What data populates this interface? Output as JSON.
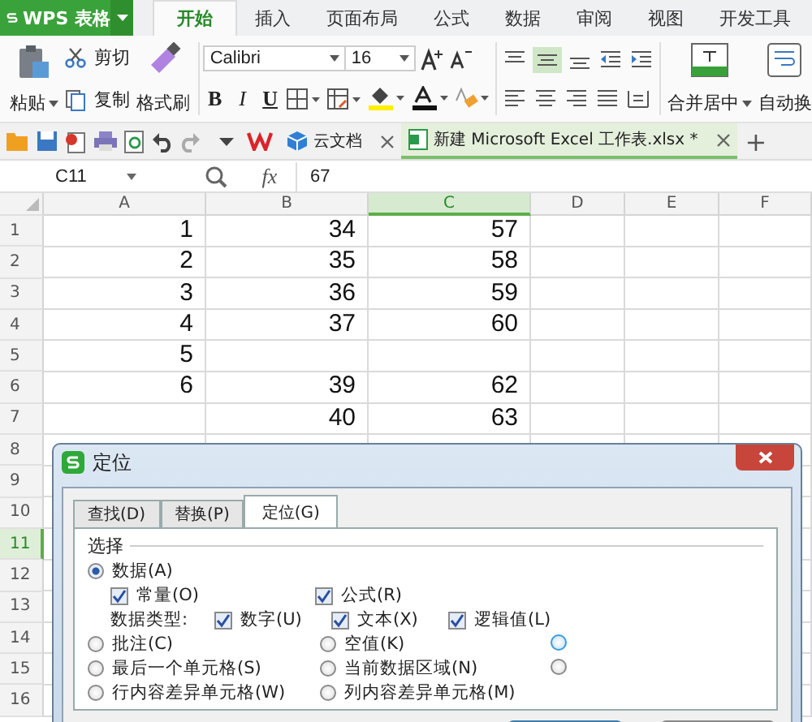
{
  "app_menu": {
    "label": "WPS 表格"
  },
  "ribbon_tabs": [
    {
      "label": "开始",
      "selected": true
    },
    {
      "label": "插入",
      "selected": false
    },
    {
      "label": "页面布局",
      "selected": false
    },
    {
      "label": "公式",
      "selected": false
    },
    {
      "label": "数据",
      "selected": false
    },
    {
      "label": "审阅",
      "selected": false
    },
    {
      "label": "视图",
      "selected": false
    },
    {
      "label": "开发工具",
      "selected": false
    }
  ],
  "ribbon": {
    "paste": "粘贴",
    "cut": "剪切",
    "copy": "复制",
    "format_painter": "格式刷",
    "font_name": "Calibri",
    "font_size": "16",
    "bold": "B",
    "italic": "I",
    "underline": "U",
    "merge": "合并居中",
    "wrap": "自动换"
  },
  "doc_tabs": [
    {
      "label": "云文档",
      "selected": false
    },
    {
      "label": "新建 Microsoft Excel 工作表.xlsx *",
      "selected": true
    }
  ],
  "doc_tab_add": "+",
  "formula_bar": {
    "cell": "C11",
    "fx": "fx",
    "value": "67"
  },
  "sheet": {
    "columns": [
      {
        "label": "A",
        "selected": false
      },
      {
        "label": "B",
        "selected": false
      },
      {
        "label": "C",
        "selected": true
      },
      {
        "label": "D",
        "selected": false
      },
      {
        "label": "E",
        "selected": false
      },
      {
        "label": "F",
        "selected": false
      }
    ],
    "rows": [
      {
        "number": "1",
        "selected": false,
        "cells": [
          "1",
          "34",
          "57"
        ]
      },
      {
        "number": "2",
        "selected": false,
        "cells": [
          "2",
          "35",
          "58"
        ]
      },
      {
        "number": "3",
        "selected": false,
        "cells": [
          "3",
          "36",
          "59"
        ]
      },
      {
        "number": "4",
        "selected": false,
        "cells": [
          "4",
          "37",
          "60"
        ]
      },
      {
        "number": "5",
        "selected": false,
        "cells": [
          "5"
        ]
      },
      {
        "number": "6",
        "selected": false,
        "cells": [
          "6",
          "39",
          "62"
        ]
      },
      {
        "number": "7",
        "selected": false,
        "cells": [
          "",
          "40",
          "63"
        ]
      },
      {
        "number": "8",
        "selected": false,
        "cells": []
      },
      {
        "number": "9",
        "selected": false,
        "cells": []
      },
      {
        "number": "10",
        "selected": false,
        "cells": []
      },
      {
        "number": "11",
        "selected": true,
        "cells": []
      },
      {
        "number": "12",
        "selected": false,
        "cells": []
      },
      {
        "number": "13",
        "selected": false,
        "cells": []
      },
      {
        "number": "14",
        "selected": false,
        "cells": []
      },
      {
        "number": "15",
        "selected": false,
        "cells": []
      },
      {
        "number": "16",
        "selected": false,
        "cells": []
      }
    ]
  },
  "dialog": {
    "title": "定位",
    "tabs": [
      {
        "label": "查找(D)",
        "selected": false
      },
      {
        "label": "替换(P)",
        "selected": false
      },
      {
        "label": "定位(G)",
        "selected": true
      }
    ],
    "group_label": "选择",
    "data_option": {
      "label": "数据(A)",
      "selected": true
    },
    "constant": {
      "label": "常量(O)",
      "checked": true
    },
    "formula": {
      "label": "公式(R)",
      "checked": true
    },
    "type_label": "数据类型:",
    "types": [
      {
        "label": "数字(U)",
        "checked": true
      },
      {
        "label": "文本(X)",
        "checked": true
      },
      {
        "label": "逻辑值(L)",
        "checked": true
      }
    ],
    "radio_rows": [
      [
        {
          "label": "批注(C)",
          "selected": false
        },
        {
          "label": "空值(K)",
          "selected": false
        },
        {
          "selected": false,
          "hover": true
        }
      ],
      [
        {
          "label": "最后一个单元格(S)",
          "selected": false
        },
        {
          "label": "当前数据区域(N)",
          "selected": false
        },
        {
          "selected": false,
          "hover": false
        }
      ],
      [
        {
          "label": "行内容差异单元格(W)",
          "selected": false
        },
        {
          "label": "列内容差异单元格(M)",
          "selected": false
        }
      ]
    ],
    "buttons": [
      {
        "default": true
      },
      {
        "default": false
      }
    ]
  }
}
